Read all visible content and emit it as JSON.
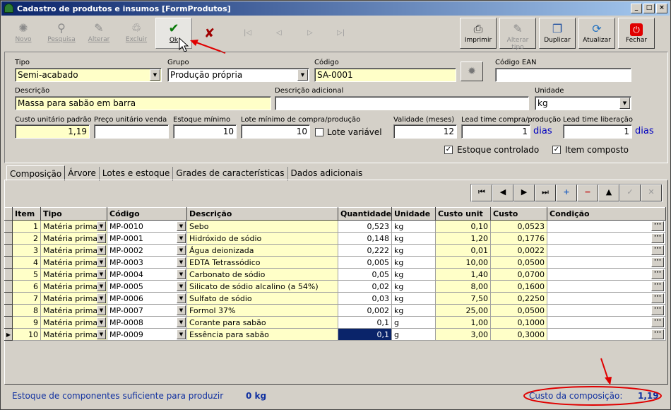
{
  "window": {
    "title": "Cadastro de produtos e insumos [FormProdutos]"
  },
  "toolbar": {
    "novo": "Novo",
    "pesquisa": "Pesquisa",
    "alterar": "Alterar",
    "excluir": "Excluir",
    "ok": "Ok",
    "imprimir": "Imprimir",
    "alterar_tipo": "Alterar tipo",
    "duplicar": "Duplicar",
    "atualizar": "Atualizar",
    "fechar": "Fechar"
  },
  "form": {
    "tipo_label": "Tipo",
    "tipo_value": "Semi-acabado",
    "grupo_label": "Grupo",
    "grupo_value": "Produção própria",
    "codigo_label": "Código",
    "codigo_value": "SA-0001",
    "ean_label": "Código EAN",
    "ean_value": "",
    "descricao_label": "Descrição",
    "descricao_value": "Massa para sabão em barra",
    "desc_adic_label": "Descrição adicional",
    "desc_adic_value": "",
    "unidade_label": "Unidade",
    "unidade_value": "kg",
    "custo_label": "Custo unitário padrão",
    "custo_value": "1,19",
    "preco_label": "Preço unitário venda",
    "preco_value": "",
    "estoque_min_label": "Estoque mínimo",
    "estoque_min_value": "10",
    "lote_min_label": "Lote mínimo de compra/produção",
    "lote_min_value": "10",
    "lote_variavel_label": "Lote variável",
    "validade_label": "Validade (meses)",
    "validade_value": "12",
    "lead_compra_label": "Lead time compra/produção",
    "lead_compra_value": "1",
    "lead_lib_label": "Lead time liberação",
    "lead_lib_value": "1",
    "dias": "dias",
    "estoque_controlado_label": "Estoque controlado",
    "item_composto_label": "Item composto"
  },
  "tabs": [
    "Composição",
    "Árvore",
    "Lotes e estoque",
    "Grades de características",
    "Dados adicionais"
  ],
  "grid": {
    "headers": [
      "Item",
      "Tipo",
      "Código",
      "Descrição",
      "Quantidade",
      "Unidade",
      "Custo unit",
      "Custo",
      "Condição"
    ],
    "rows": [
      [
        "1",
        "Matéria prima",
        "MP-0010",
        "Sebo",
        "0,523",
        "kg",
        "0,10",
        "0,0523"
      ],
      [
        "2",
        "Matéria prima",
        "MP-0001",
        "Hidróxido de sódio",
        "0,148",
        "kg",
        "1,20",
        "0,1776"
      ],
      [
        "3",
        "Matéria prima",
        "MP-0002",
        "Água deionizada",
        "0,222",
        "kg",
        "0,01",
        "0,0022"
      ],
      [
        "4",
        "Matéria prima",
        "MP-0003",
        "EDTA Tetrassódico",
        "0,005",
        "kg",
        "10,00",
        "0,0500"
      ],
      [
        "5",
        "Matéria prima",
        "MP-0004",
        "Carbonato de sódio",
        "0,05",
        "kg",
        "1,40",
        "0,0700"
      ],
      [
        "6",
        "Matéria prima",
        "MP-0005",
        "Silicato de sódio alcalino (a 54%)",
        "0,02",
        "kg",
        "8,00",
        "0,1600"
      ],
      [
        "7",
        "Matéria prima",
        "MP-0006",
        "Sulfato de sódio",
        "0,03",
        "kg",
        "7,50",
        "0,2250"
      ],
      [
        "8",
        "Matéria prima",
        "MP-0007",
        "Formol 37%",
        "0,002",
        "kg",
        "25,00",
        "0,0500"
      ],
      [
        "9",
        "Matéria prima",
        "MP-0008",
        "Corante para sabão",
        "0,1",
        "g",
        "1,00",
        "0,1000"
      ],
      [
        "10",
        "Matéria prima",
        "MP-0009",
        "Essência para sabão",
        "0,1",
        "g",
        "3,00",
        "0,3000"
      ]
    ]
  },
  "status": {
    "estoque_text": "Estoque de componentes suficiente para produzir",
    "estoque_value": "0 kg",
    "custo_label": "Custo da composição:",
    "custo_value": "1,19"
  },
  "colors": {
    "title_start": "#0a246a",
    "required_field": "#ffffc8",
    "annotation": "#e00000"
  }
}
